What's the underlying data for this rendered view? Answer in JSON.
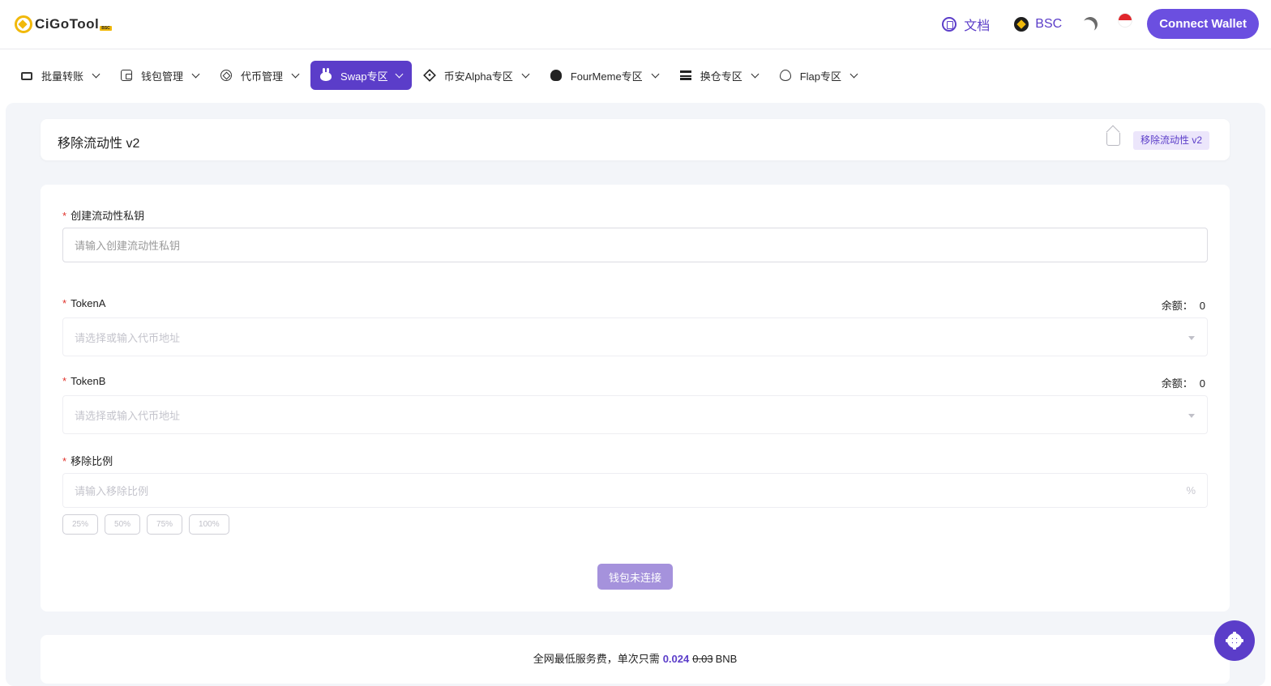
{
  "header": {
    "logo_text": "CiGoTool",
    "logo_badge": "BSC",
    "doc_label": "文档",
    "chain_label": "BSC",
    "connect_label": "Connect Wallet"
  },
  "nav": {
    "items": [
      {
        "label": "批量转账",
        "icon": "transfer-icon"
      },
      {
        "label": "钱包管理",
        "icon": "wallet-icon"
      },
      {
        "label": "代币管理",
        "icon": "coin-icon"
      },
      {
        "label": "Swap专区",
        "icon": "bunny-icon",
        "active": true
      },
      {
        "label": "币安Alpha专区",
        "icon": "alpha-icon"
      },
      {
        "label": "FourMeme专区",
        "icon": "frog-icon"
      },
      {
        "label": "换仓专区",
        "icon": "stack-icon"
      },
      {
        "label": "Flap专区",
        "icon": "butterfly-icon"
      }
    ]
  },
  "page": {
    "title": "移除流动性 v2",
    "breadcrumb": "移除流动性 v2"
  },
  "form": {
    "private_key": {
      "label": "创建流动性私钥",
      "placeholder": "请输入创建流动性私钥"
    },
    "token_a": {
      "label": "TokenA",
      "placeholder": "请选择或输入代币地址",
      "balance_label": "余额：",
      "balance": "0"
    },
    "token_b": {
      "label": "TokenB",
      "placeholder": "请选择或输入代币地址",
      "balance_label": "余额：",
      "balance": "0"
    },
    "ratio": {
      "label": "移除比例",
      "placeholder": "请输入移除比例",
      "suffix": "%"
    },
    "presets": [
      "25%",
      "50%",
      "75%",
      "100%"
    ],
    "submit_label": "钱包未连接"
  },
  "fee": {
    "text": "全网最低服务费，单次只需",
    "current": "0.024",
    "original": "0.03",
    "unit": "BNB"
  },
  "colors": {
    "accent": "#5b3dc9",
    "connect": "#6b4fe0",
    "required": "#e0322b"
  }
}
